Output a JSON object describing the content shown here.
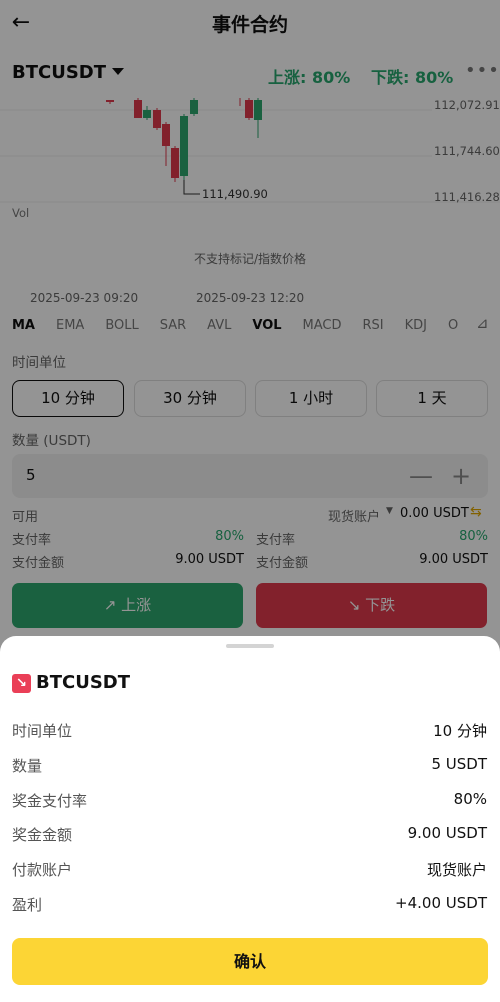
{
  "header": {
    "back_icon": "arrow-left-icon",
    "title": "事件合约"
  },
  "market": {
    "symbol": "BTCUSDT",
    "up_odds": "上涨: 80%",
    "down_odds": "下跌: 80%",
    "more_icon": "more-icon"
  },
  "chart": {
    "price_labels": [
      "112,072.91",
      "111,744.60",
      "111,416.28"
    ],
    "low_marker": "111,490.90",
    "vol_label": "Vol",
    "notice": "不支持标记/指数价格",
    "time_labels": [
      "2025-09-23 09:20",
      "2025-09-23 12:20"
    ],
    "up_color": "#2ea86e",
    "down_color": "#e0394d"
  },
  "indicators": [
    "MA",
    "EMA",
    "BOLL",
    "SAR",
    "AVL",
    "VOL",
    "MACD",
    "RSI",
    "KDJ",
    "O"
  ],
  "time_unit": {
    "label": "时间单位",
    "options": [
      "10 分钟",
      "30 分钟",
      "1 小时",
      "1 天"
    ],
    "selected": "10 分钟"
  },
  "quantity": {
    "label": "数量 (USDT)",
    "value": "5",
    "minus": "—",
    "plus": "+"
  },
  "account": {
    "available_label": "可用",
    "account_name": "现货账户",
    "balance": "0.00 USDT"
  },
  "left_panel": {
    "rate_label": "支付率",
    "rate": "80%",
    "amount_label": "支付金额",
    "amount": "9.00 USDT"
  },
  "right_panel": {
    "rate_label": "支付率",
    "rate": "80%",
    "amount_label": "支付金额",
    "amount": "9.00 USDT"
  },
  "buttons": {
    "up": "↗ 上涨",
    "down": "↘ 下跌"
  },
  "sheet": {
    "symbol": "BTCUSDT",
    "direction_icon": "arrow-down-right-icon",
    "rows": [
      {
        "label": "时间单位",
        "value": "10 分钟"
      },
      {
        "label": "数量",
        "value": "5 USDT"
      },
      {
        "label": "奖金支付率",
        "value": "80%"
      },
      {
        "label": "奖金金额",
        "value": "9.00 USDT"
      },
      {
        "label": "付款账户",
        "value": "现货账户"
      },
      {
        "label": "盈利",
        "value": "+4.00 USDT"
      }
    ],
    "confirm": "确认"
  }
}
